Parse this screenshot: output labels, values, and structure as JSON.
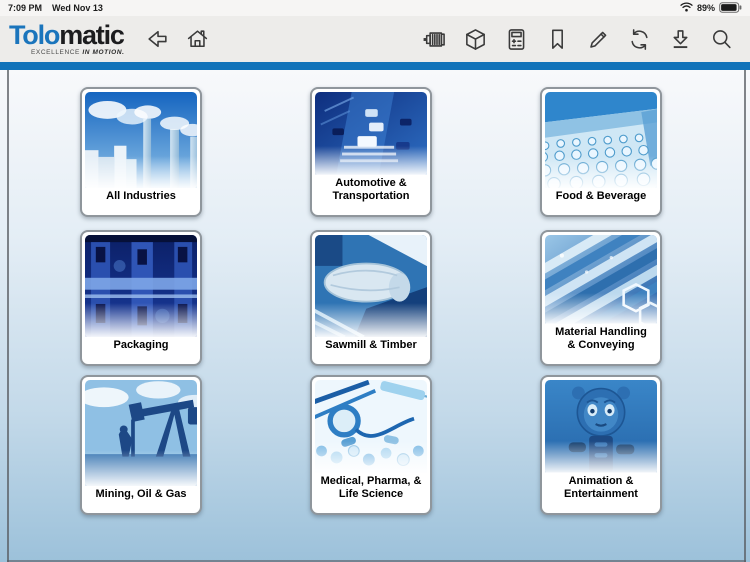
{
  "status_bar": {
    "time": "7:09 PM",
    "date": "Wed Nov 13",
    "battery_percent": "89%",
    "icons": [
      "wifi-icon",
      "battery-icon"
    ]
  },
  "toolbar": {
    "logo_primary": "Tolo",
    "logo_secondary": "matic",
    "tagline_regular": "EXCELLENCE",
    "tagline_bold": "IN MOTION.",
    "left_icons": [
      "back-icon",
      "home-icon"
    ],
    "right_icons": [
      "motor-icon",
      "cube-icon",
      "calculator-icon",
      "bookmark-icon",
      "pencil-icon",
      "sync-icon",
      "download-icon",
      "search-icon"
    ]
  },
  "colors": {
    "brand_blue": "#1273b9",
    "logo_blue": "#1b75bc",
    "background_top": "#f8f9fb",
    "background_bottom": "#9cc1da"
  },
  "grid": {
    "items": [
      {
        "label": "All Industries",
        "image": "factory-smokestacks"
      },
      {
        "label": "Automotive & Transportation",
        "image": "highway-traffic"
      },
      {
        "label": "Food & Beverage",
        "image": "bottling-line"
      },
      {
        "label": "Packaging",
        "image": "packaging-machine"
      },
      {
        "label": "Sawmill & Timber",
        "image": "sawmill-log"
      },
      {
        "label": "Material Handling & Conveying",
        "image": "conveyor-rollers"
      },
      {
        "label": "Mining, Oil & Gas",
        "image": "oil-pumpjack"
      },
      {
        "label": "Medical, Pharma, & Life Science",
        "image": "medical-instruments"
      },
      {
        "label": "Animation & Entertainment",
        "image": "animatronic-robot"
      }
    ]
  }
}
